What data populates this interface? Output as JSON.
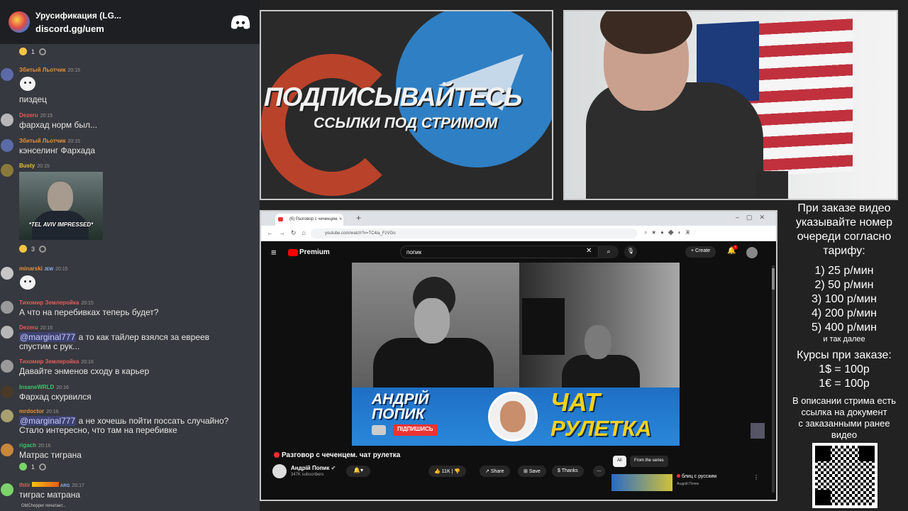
{
  "discord": {
    "server_name": "Урусификация (LG...",
    "invite": "discord.gg/uem",
    "typing_indicator": "OldChopper печатает...",
    "messages": [
      {
        "reaction_count": "1"
      },
      {
        "user": "Збитый Льотчик",
        "time": "20:15",
        "user_color": "#e8913a",
        "text": "пиздец"
      },
      {
        "user": "Dezeru",
        "time": "20:15",
        "user_color": "#e85a5a",
        "text": "фархад норм был..."
      },
      {
        "user": "Збитый Льотчик",
        "time": "20:15",
        "user_color": "#e8913a",
        "text": "кэнселинг Фархада"
      },
      {
        "user": "Busty",
        "time": "20:15",
        "user_color": "#e8c13a",
        "image_caption": "*TEL AVIV IMPRESSED*",
        "reaction_count": "3"
      },
      {
        "user": "minarski",
        "badge": "JEW",
        "time": "20:15",
        "user_color": "#e8913a"
      },
      {
        "user": "Тихомир Землеройка",
        "time": "20:15",
        "user_color": "#e85a5a",
        "text": "А что на перебивках теперь будет?"
      },
      {
        "user": "Dezeru",
        "time": "20:16",
        "user_color": "#e85a5a",
        "mention": "@marginal777",
        "text": " а то как тайлер взялся за евреев",
        "text2": "спустим с рук..."
      },
      {
        "user": "Тихомир Землеройка",
        "time": "20:16",
        "user_color": "#e85a5a",
        "text": "Давайте энменов сходу в карьер"
      },
      {
        "user": "InsaneWRLD",
        "time": "20:16",
        "user_color": "#3ac46a",
        "text": "Фархад скурвился"
      },
      {
        "user": "mrdoctor",
        "time": "20:16",
        "user_color": "#e8913a",
        "mention": "@marginal777",
        "text": " а не хочешь пойти поссать случайно?",
        "text2": "Стало интересно, что там на перебивке"
      },
      {
        "user": "rigach",
        "time": "20:16",
        "user_color": "#3ac46a",
        "text": "Матрас тиграна",
        "reaction_count": "1"
      },
      {
        "user": "thtir",
        "badge": "ARG",
        "time": "20:17",
        "user_color": "#e85a5a",
        "text": "тиграс матрана"
      }
    ]
  },
  "promo": {
    "title": "ПОДПИСЫВАЙТЕСЬ",
    "subtitle": "ССЫЛКИ ПОД СТРИМОМ"
  },
  "browser": {
    "tab_title": "(6) Разговор с чеченцем. ч",
    "url": "youtube.com/watch?v=TC4ia_FzVGo",
    "brand": "Premium",
    "search_value": "попик",
    "create_label": "Create",
    "notification_count": "9",
    "video": {
      "banner_name_line1": "АНДРІЙ",
      "banner_name_line2": "ПОПИК",
      "banner_subscribe": "ПІДПИШИСЬ",
      "banner_title_line1": "ЧАТ",
      "banner_title_line2": "РУЛЕТКА"
    },
    "title": "Разговор с чеченцем. чат рулетка",
    "channel": "Андрій Попик",
    "subscribers": "347K subscribers",
    "likes": "11K",
    "share_label": "Share",
    "save_label": "Save",
    "thanks_label": "Thanks",
    "chips": [
      "All",
      "From the series"
    ],
    "rec_title": "блиц с русским",
    "rec_channel": "Андрій Попик"
  },
  "prices": {
    "intro": [
      "При заказе видео",
      "указывайте номер",
      "очереди согласно",
      "тарифу:"
    ],
    "tiers": [
      "1) 25 р/мин",
      "2) 50 р/мин",
      "3) 100 р/мин",
      "4) 200 р/мин",
      "5) 400 р/мин"
    ],
    "etc": "и так далее",
    "rates_title": "Курсы при заказе:",
    "rates": [
      "1$ = 100р",
      "1€ = 100р"
    ],
    "note": [
      "В описании стрима есть",
      "ссылка на документ",
      "с заказанными ранее",
      "видео"
    ]
  }
}
